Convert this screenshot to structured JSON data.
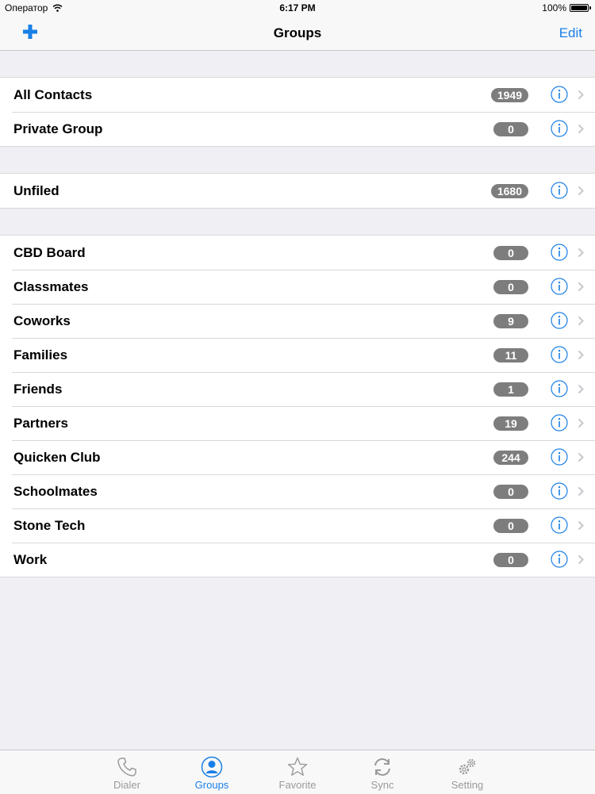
{
  "status_bar": {
    "carrier": "Оператор",
    "time": "6:17 PM",
    "battery": "100%"
  },
  "nav": {
    "title": "Groups",
    "edit_label": "Edit",
    "add_icon": "plus-icon"
  },
  "sections": [
    {
      "rows": [
        {
          "label": "All Contacts",
          "count": "1949"
        },
        {
          "label": "Private Group",
          "count": "0"
        }
      ]
    },
    {
      "rows": [
        {
          "label": "Unfiled",
          "count": "1680"
        }
      ]
    },
    {
      "rows": [
        {
          "label": "CBD Board",
          "count": "0"
        },
        {
          "label": "Classmates",
          "count": "0"
        },
        {
          "label": "Coworks",
          "count": "9"
        },
        {
          "label": "Families",
          "count": "11"
        },
        {
          "label": "Friends",
          "count": "1"
        },
        {
          "label": "Partners",
          "count": "19"
        },
        {
          "label": "Quicken Club",
          "count": "244"
        },
        {
          "label": "Schoolmates",
          "count": "0"
        },
        {
          "label": "Stone Tech",
          "count": "0"
        },
        {
          "label": "Work",
          "count": "0"
        }
      ]
    }
  ],
  "tabs": [
    {
      "label": "Dialer",
      "icon": "phone-icon"
    },
    {
      "label": "Groups",
      "icon": "person-icon",
      "active": true
    },
    {
      "label": "Favorite",
      "icon": "star-icon"
    },
    {
      "label": "Sync",
      "icon": "sync-icon"
    },
    {
      "label": "Setting",
      "icon": "gears-icon"
    }
  ],
  "colors": {
    "accent": "#1a7fe6",
    "badge": "#7d7d7d",
    "background": "#efeff4",
    "inactive_tab": "#9a9a9a"
  }
}
